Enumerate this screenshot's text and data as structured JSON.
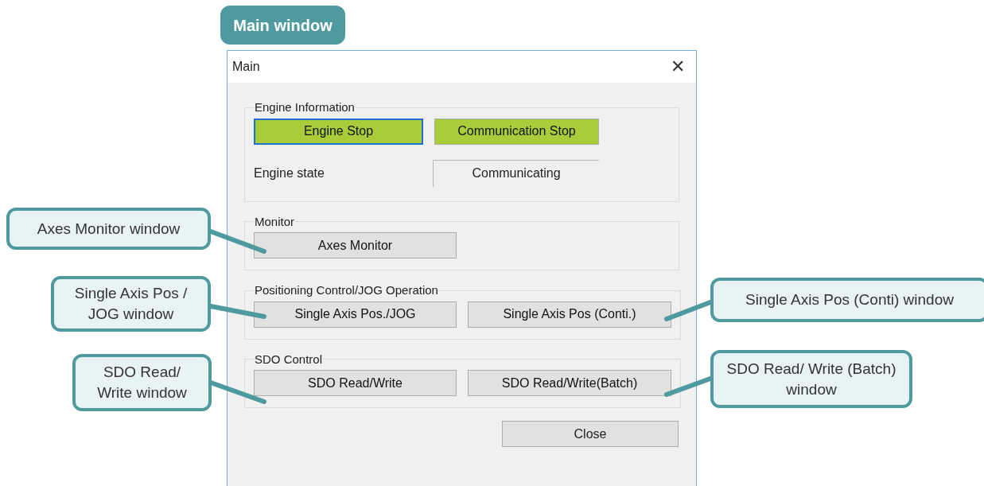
{
  "figure_label": "Main window",
  "window": {
    "title": "Main",
    "close": "✕"
  },
  "groups": [
    {
      "title": "Engine Information",
      "kind": "engine",
      "buttons": [
        {
          "label": "Engine Stop",
          "highlighted": true,
          "focused": true
        },
        {
          "label": "Communication Stop",
          "highlighted": true,
          "focused": false
        }
      ],
      "status_label": "Engine state",
      "status_value": "Communicating"
    },
    {
      "title": "Monitor",
      "kind": "buttons",
      "buttons": [
        {
          "label": "Axes Monitor",
          "highlighted": false,
          "focused": false
        }
      ]
    },
    {
      "title": "Positioning Control/JOG Operation",
      "kind": "buttons",
      "buttons": [
        {
          "label": "Single Axis Pos./JOG",
          "highlighted": false,
          "focused": false
        },
        {
          "label": "Single Axis Pos (Conti.)",
          "highlighted": false,
          "focused": false
        }
      ]
    },
    {
      "title": "SDO Control",
      "kind": "buttons",
      "buttons": [
        {
          "label": "SDO Read/Write",
          "highlighted": false,
          "focused": false
        },
        {
          "label": "SDO Read/Write(Batch)",
          "highlighted": false,
          "focused": false
        }
      ]
    }
  ],
  "close_button": "Close",
  "callouts": [
    {
      "text": "Axes Monitor window"
    },
    {
      "text": "Single Axis Pos / JOG window"
    },
    {
      "text": "SDO Read/ Write window"
    },
    {
      "text": "Single Axis Pos (Conti) window"
    },
    {
      "text": "SDO Read/ Write (Batch) window"
    }
  ]
}
